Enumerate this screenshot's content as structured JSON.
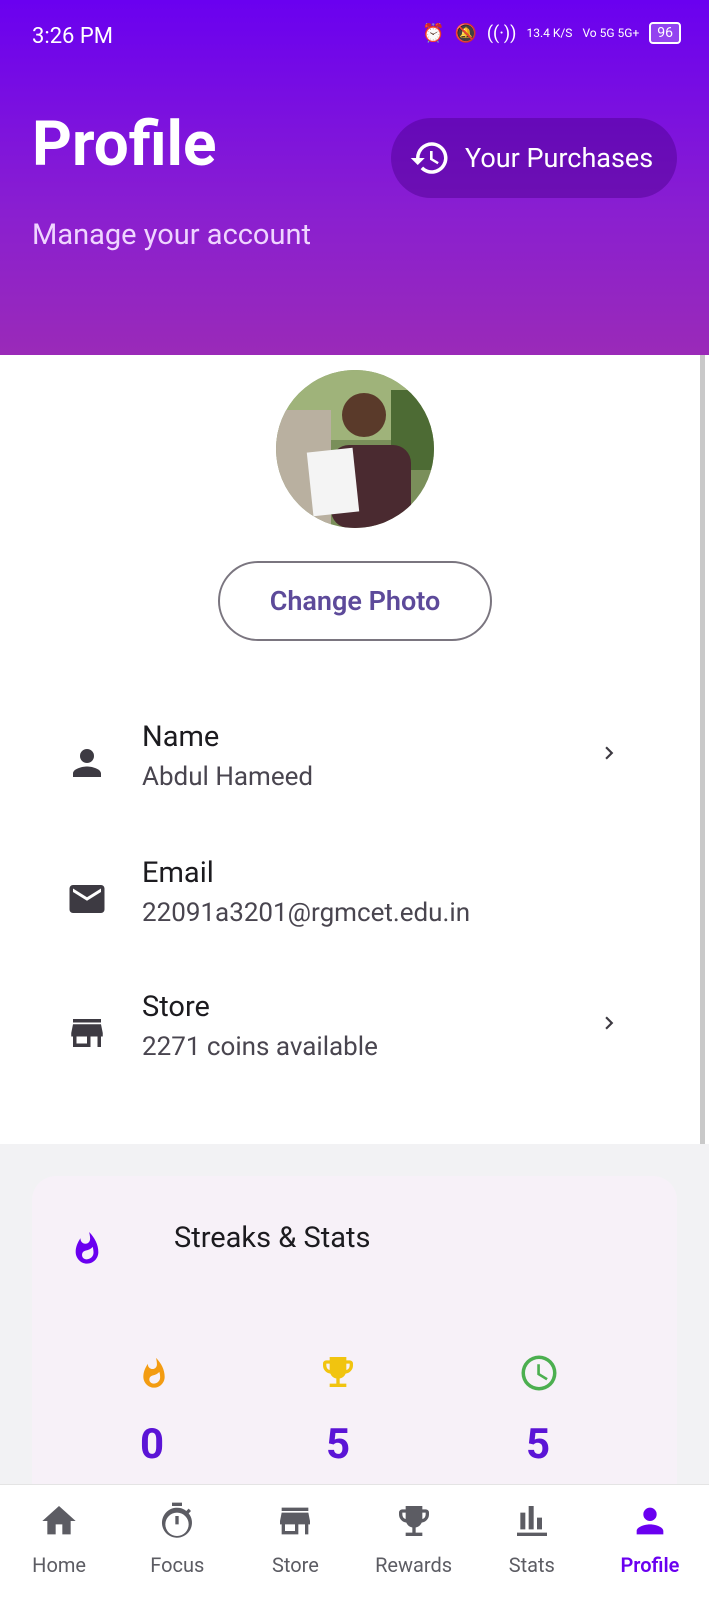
{
  "status": {
    "time": "3:26 PM",
    "net_speed": "13.4 K/S",
    "signal": "Vo 5G 5G+",
    "battery": "96"
  },
  "header": {
    "title": "Profile",
    "subtitle": "Manage your account",
    "purchases_label": "Your Purchases"
  },
  "profile": {
    "change_photo_label": "Change Photo"
  },
  "rows": [
    {
      "label": "Name",
      "value": "Abdul Hameed"
    },
    {
      "label": "Email",
      "value": "22091a3201@rgmcet.edu.in"
    },
    {
      "label": "Store",
      "value": "2271 coins available"
    }
  ],
  "stats": {
    "title": "Streaks & Stats",
    "values": [
      "0",
      "5",
      "5"
    ]
  },
  "nav": [
    "Home",
    "Focus",
    "Store",
    "Rewards",
    "Stats",
    "Profile"
  ],
  "colors": {
    "primary": "#6a00f0",
    "accent_orange": "#f39c12",
    "accent_gold": "#f1c40f",
    "accent_green": "#4caf50"
  }
}
